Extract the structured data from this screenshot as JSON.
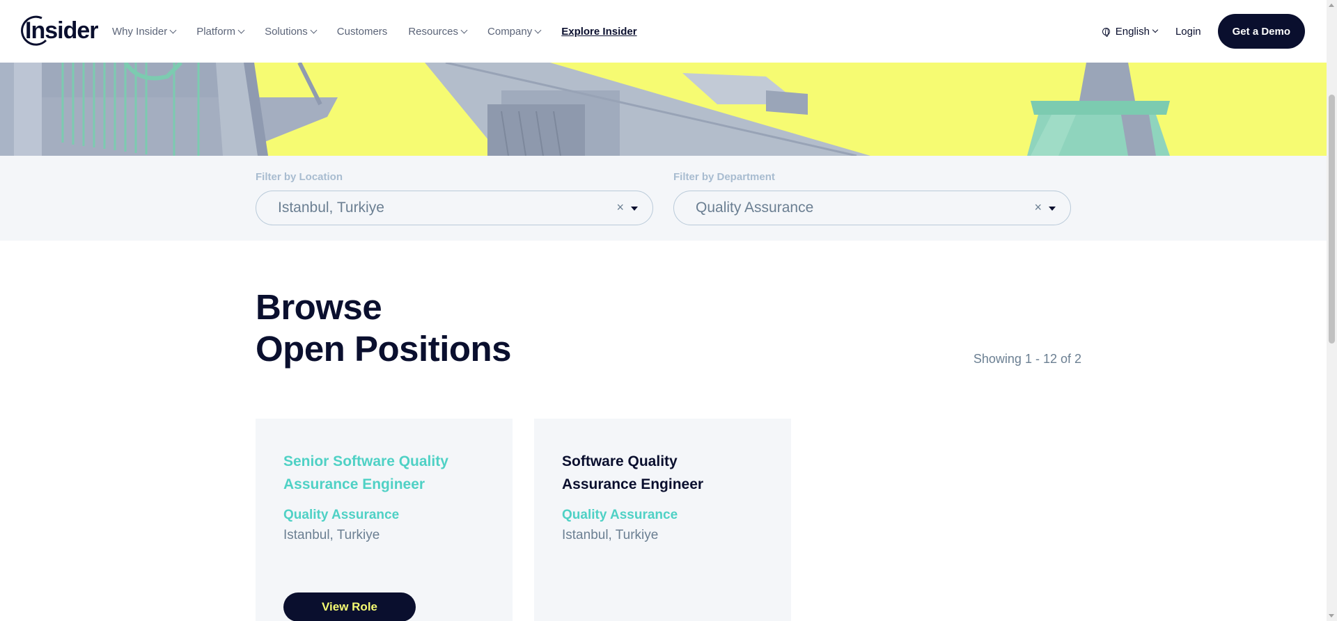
{
  "nav": {
    "logo_text": "Insider",
    "menu": [
      {
        "label": "Why Insider",
        "dropdown": true
      },
      {
        "label": "Platform",
        "dropdown": true
      },
      {
        "label": "Solutions",
        "dropdown": true
      },
      {
        "label": "Customers",
        "dropdown": false
      },
      {
        "label": "Resources",
        "dropdown": true
      },
      {
        "label": "Company",
        "dropdown": true
      },
      {
        "label": "Explore Insider",
        "dropdown": false
      }
    ],
    "language": "English",
    "login": "Login",
    "demo_button": "Get a Demo"
  },
  "filters": {
    "location": {
      "label": "Filter by Location",
      "value": "Istanbul, Turkiye"
    },
    "department": {
      "label": "Filter by Department",
      "value": "Quality Assurance"
    },
    "clear_glyph": "×"
  },
  "listing": {
    "heading_line1": "Browse",
    "heading_line2": "Open Positions",
    "showing": "Showing 1 - 12 of 2"
  },
  "jobs": [
    {
      "title_line1": "Senior Software Quality",
      "title_line2": "Assurance Engineer",
      "department": "Quality Assurance",
      "location": "Istanbul, Turkiye",
      "button": "View Role"
    },
    {
      "title_line1": "Software Quality",
      "title_line2": "Assurance Engineer",
      "department": "Quality Assurance",
      "location": "Istanbul, Turkiye"
    }
  ],
  "colors": {
    "navy": "#0a0f2e",
    "accent_yellow": "#f6fb72",
    "accent_teal": "#4fd1c5",
    "muted_text": "#6b7f92",
    "filter_bg": "#f4f6f9"
  }
}
